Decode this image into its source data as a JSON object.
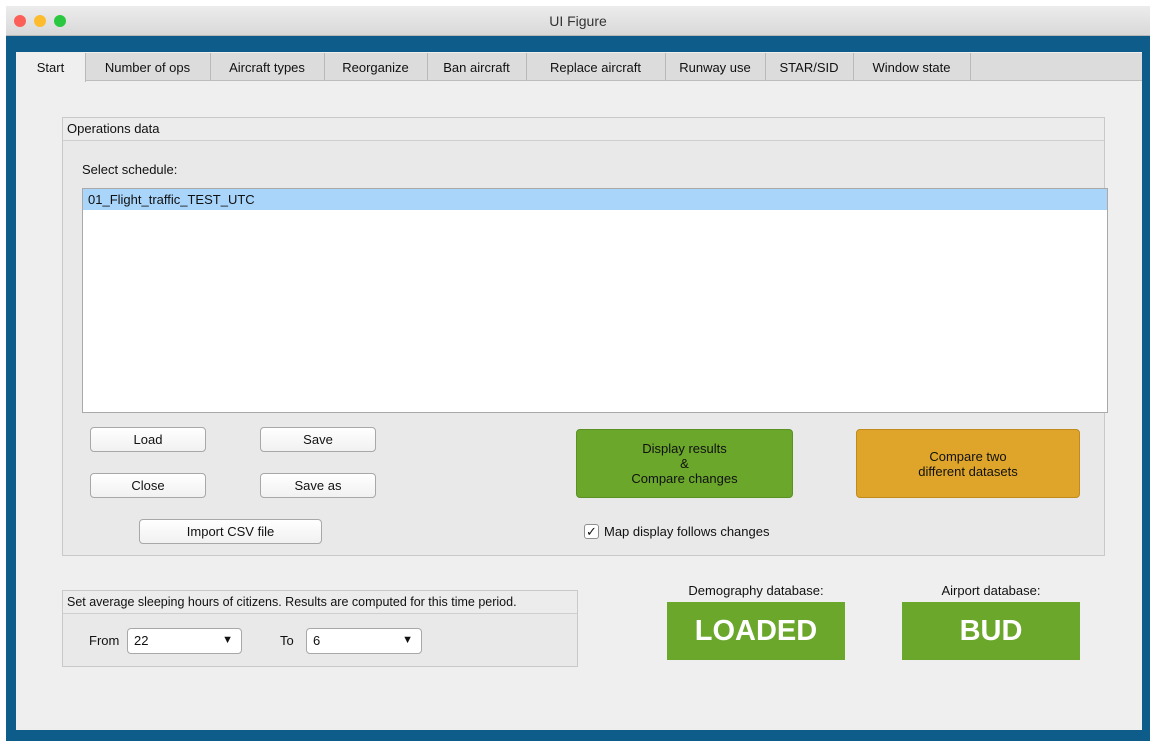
{
  "window": {
    "title": "UI Figure"
  },
  "tabs": [
    "Start",
    "Number of ops",
    "Aircraft types",
    "Reorganize",
    "Ban aircraft",
    "Replace aircraft",
    "Runway use",
    "STAR/SID",
    "Window state"
  ],
  "operations": {
    "panel_title": "Operations data",
    "select_label": "Select schedule:",
    "schedules": [
      "01_Flight_traffic_TEST_UTC"
    ],
    "buttons": {
      "load": "Load",
      "save": "Save",
      "close": "Close",
      "save_as": "Save as",
      "import": "Import CSV file"
    },
    "display_results": [
      "Display results",
      "&",
      "Compare changes"
    ],
    "compare_two": [
      "Compare two",
      "different datasets"
    ],
    "map_follows": "Map display follows changes",
    "map_follows_checked": true
  },
  "sleep": {
    "panel_title": "Set average sleeping hours of citizens. Results are computed for this time period.",
    "from_label": "From",
    "from_value": "22",
    "to_label": "To",
    "to_value": "6"
  },
  "databases": {
    "demography_label": "Demography database:",
    "demography_value": "LOADED",
    "airport_label": "Airport database:",
    "airport_value": "BUD"
  },
  "colors": {
    "frame": "#0e5c8a",
    "green": "#6aa72b",
    "orange": "#dfa52a",
    "selection": "#a9d5fb"
  }
}
